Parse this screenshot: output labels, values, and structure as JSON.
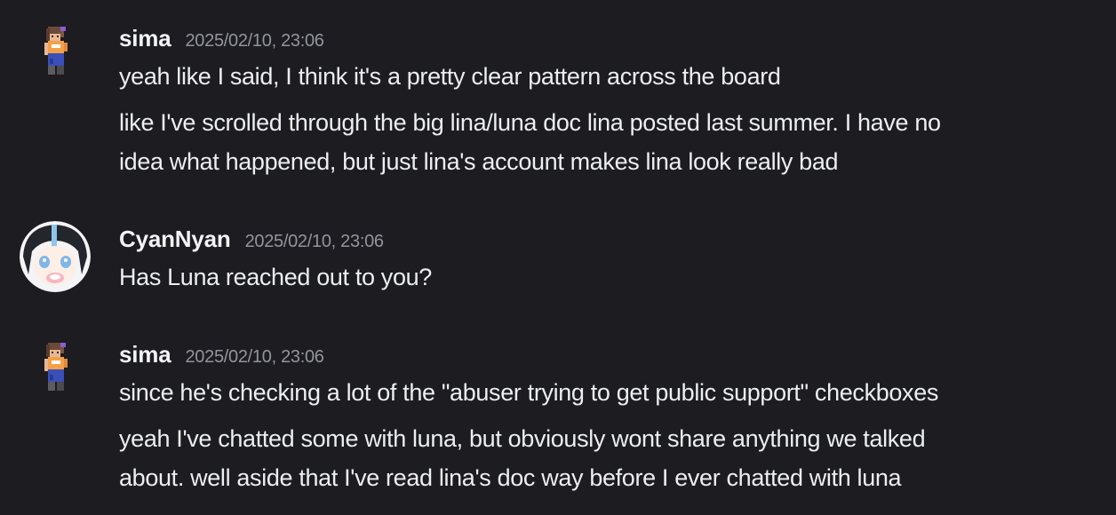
{
  "messages": [
    {
      "author": "sima",
      "timestamp": "2025/02/10, 23:06",
      "avatar_icon": "pixel-character-avatar",
      "lines": [
        "yeah like I said, I think it's a pretty clear pattern across the board",
        "like I've scrolled through the big lina/luna doc lina posted last summer. I have no",
        "idea what happened, but just lina's account makes lina look really bad"
      ]
    },
    {
      "author": "CyanNyan",
      "timestamp": "2025/02/10, 23:06",
      "avatar_icon": "anime-girl-avatar",
      "lines": [
        "Has Luna reached out to you?"
      ]
    },
    {
      "author": "sima",
      "timestamp": "2025/02/10, 23:06",
      "avatar_icon": "pixel-character-avatar",
      "lines": [
        "since he's checking a lot of the \"abuser trying to get public support\" checkboxes",
        "yeah I've chatted some with luna, but obviously wont share anything we talked",
        "about. well aside that I've read lina's doc way before I ever chatted with luna"
      ]
    }
  ],
  "colors": {
    "background": "#1c1c21",
    "text": "#eceef1",
    "username": "#f2f3f5",
    "timestamp": "#93949c"
  }
}
